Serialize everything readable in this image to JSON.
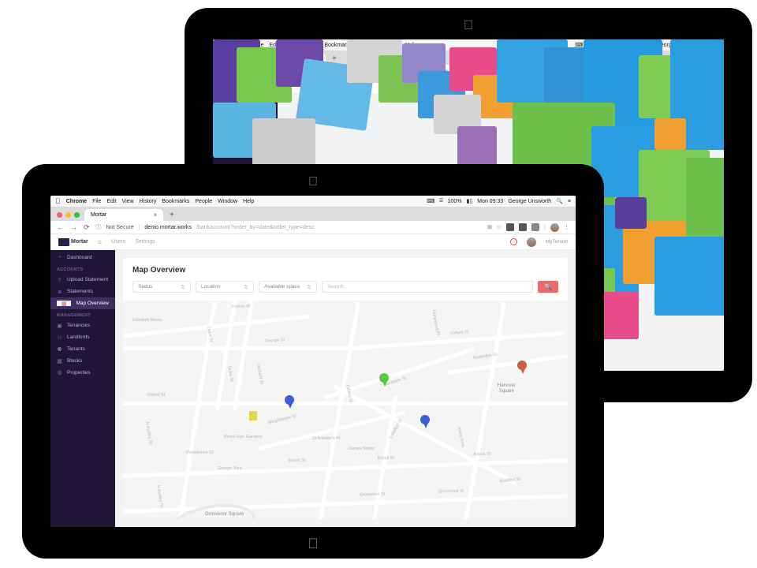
{
  "menubar": {
    "app": "Chrome",
    "items": [
      "File",
      "Edit",
      "View",
      "History",
      "Bookmarks",
      "People",
      "Window",
      "Help"
    ],
    "battery": "100%",
    "clock": "Mon 09:33",
    "user": "George Unsworth"
  },
  "browser": {
    "tab_title": "Mortar",
    "not_secure": "Not Secure",
    "url_dark": "demo.mortar.works",
    "url_light": "/bankaccount/?order_by=date&order_type=desc"
  },
  "app": {
    "brand": "Mortar",
    "nav": {
      "users": "Users",
      "settings": "Settings"
    },
    "account_user": "MyTenant"
  },
  "sidebar": {
    "dashboard": "Dashboard",
    "section_accounts": "ACCOUNTS",
    "upload_statement": "Upload Statement",
    "statements": "Statements",
    "map_overview": "Map Overview",
    "section_management": "MANAGEMENT",
    "tenancies": "Tenancies",
    "landlords": "Landlords",
    "tenants": "Tenants",
    "blocks": "Blocks",
    "properties": "Properties"
  },
  "page": {
    "title": "Map Overview",
    "filters": {
      "status": "Status",
      "location": "Location",
      "space": "Available space"
    },
    "search_placeholder": "Search..."
  },
  "map": {
    "streets": [
      "Foxton Pl",
      "Edwards Mews",
      "Duke St",
      "George St",
      "Duke St",
      "Orchard St",
      "Oxford St",
      "Oxford St",
      "Tenterden St",
      "Blenheim St",
      "Weighhouse St",
      "Brook Hart Gardens",
      "Providence Ct",
      "George Yard",
      "N Audley St",
      "S Molton St",
      "Davies Mews",
      "St Anselm's Pl",
      "Brook St",
      "Brook St",
      "Brook St",
      "Grosvenor St",
      "Grosvenor St",
      "Maddox St",
      "Hanywood Pl",
      "Gilbert St",
      "Avery Row",
      "N Audley St"
    ],
    "hanover": "Hanover\nSquare",
    "grosvenor": "Grosvenor Square"
  }
}
